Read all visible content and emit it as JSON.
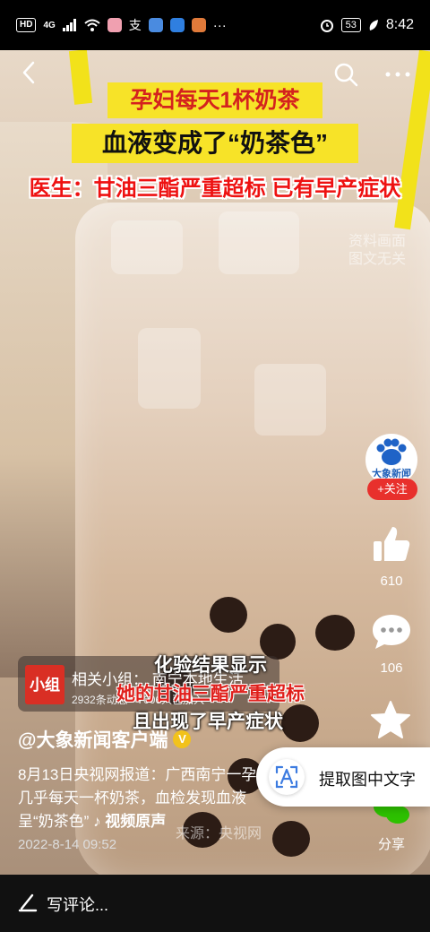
{
  "status_bar": {
    "network_badge": "HD",
    "signal_label": "4G",
    "battery": "53",
    "time": "8:42",
    "more": "···"
  },
  "top_bar": {
    "back_icon": "chevron-left-icon",
    "search_icon": "search-icon",
    "more_icon": "more-horizontal-icon"
  },
  "video": {
    "headline_1": "孕妇每天1杯奶茶",
    "headline_2": "血液变成了“奶茶色”",
    "headline_3": "医生：甘油三酯严重超标 已有早产症状",
    "watermark_line1": "资料画面",
    "watermark_line2": "图文无关",
    "subtitle_1": "化验结果显示",
    "subtitle_2": "她的甘油三酯严重超标",
    "subtitle_3": "且出现了早产症状",
    "source_watermark": "来源：央视网"
  },
  "author_avatar": {
    "name": "大象新闻"
  },
  "follow_button": {
    "label": "+关注"
  },
  "actions": {
    "like_count": "610",
    "comment_count": "106",
    "share_label": "分享"
  },
  "group_card": {
    "logo_text": "小组",
    "title": "相关小组：  南宁本地生活",
    "stats": "2932条动态 · 7006人已加入"
  },
  "post": {
    "author": "@大象新闻客户端",
    "description": "8月13日央视网报道：广西南宁一孕妇几乎每天一杯奶茶，血检发现血液呈“奶茶色”",
    "video_link": "♪ 视频原声",
    "date": "2022-8-14 09:52"
  },
  "ocr_pill": {
    "label": "提取图中文字"
  },
  "comment_bar": {
    "placeholder": "写评论..."
  },
  "colors": {
    "headline_bg": "#f7e328",
    "headline_red": "#d4221e",
    "follow_red": "#e8302c",
    "verified": "#f2c21b"
  }
}
